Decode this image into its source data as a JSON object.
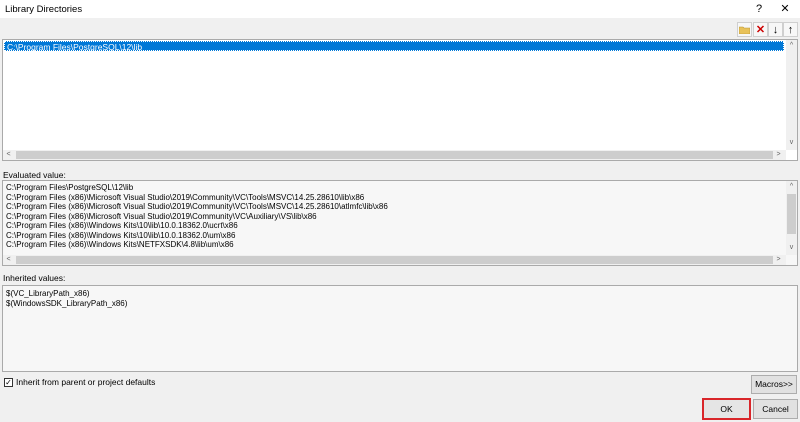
{
  "window": {
    "title": "Library Directories",
    "help_glyph": "?",
    "close_glyph": "✕"
  },
  "toolbar": {
    "icons": [
      "new-line-folder-icon",
      "delete-icon",
      "move-down-icon",
      "move-up-icon"
    ],
    "glyphs": {
      "delete": "✕",
      "down": "↓",
      "up": "↑"
    }
  },
  "list": {
    "items": [
      "C:\\Program Files\\PostgreSQL\\12\\lib"
    ]
  },
  "evaluated": {
    "label": "Evaluated value:",
    "lines": [
      "C:\\Program Files\\PostgreSQL\\12\\lib",
      "C:\\Program Files (x86)\\Microsoft Visual Studio\\2019\\Community\\VC\\Tools\\MSVC\\14.25.28610\\lib\\x86",
      "C:\\Program Files (x86)\\Microsoft Visual Studio\\2019\\Community\\VC\\Tools\\MSVC\\14.25.28610\\atlmfc\\lib\\x86",
      "C:\\Program Files (x86)\\Microsoft Visual Studio\\2019\\Community\\VC\\Auxiliary\\VS\\lib\\x86",
      "C:\\Program Files (x86)\\Windows Kits\\10\\lib\\10.0.18362.0\\ucrt\\x86",
      "C:\\Program Files (x86)\\Windows Kits\\10\\lib\\10.0.18362.0\\um\\x86",
      "C:\\Program Files (x86)\\Windows Kits\\NETFXSDK\\4.8\\lib\\um\\x86"
    ]
  },
  "inherited": {
    "label": "Inherited values:",
    "lines": [
      "$(VC_LibraryPath_x86)",
      "$(WindowsSDK_LibraryPath_x86)"
    ]
  },
  "inherit_checkbox": {
    "checked": true,
    "check_glyph": "✓",
    "label": "Inherit from parent or project defaults"
  },
  "buttons": {
    "macros": "Macros>>",
    "ok": "OK",
    "cancel": "Cancel"
  },
  "scroll_glyphs": {
    "left": "<",
    "right": ">",
    "up": "^",
    "down": "v"
  },
  "colors": {
    "selection": "#0078d7",
    "ok_highlight": "#d9262a"
  }
}
